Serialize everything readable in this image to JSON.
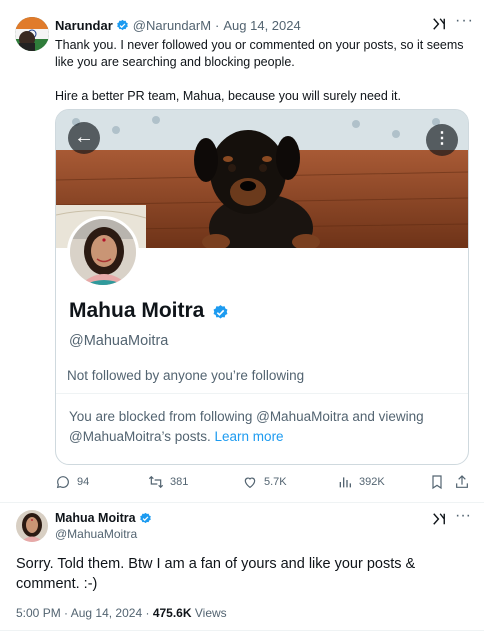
{
  "tweet1": {
    "author_name": "Narundar",
    "author_handle": "@NarundarM",
    "separator": "·",
    "date": "Aug 14, 2024",
    "text": "Thank you. I never followed you or commented on your posts, so it seems like you are searching and blocking people.\n\nHire a better PR team, Mahua, because you will surely need it.",
    "actions": {
      "replies": "94",
      "reposts": "381",
      "likes": "5.7K",
      "views": "392K"
    }
  },
  "card": {
    "profile_name": "Mahua Moitra",
    "profile_handle": "@MahuaMoitra",
    "followers_note": "Not followed by anyone you’re following",
    "blocked_text": "You are blocked from following @MahuaMoitra and viewing @MahuaMoitra’s posts.",
    "learn_more": "Learn more"
  },
  "tweet2": {
    "author_name": "Mahua Moitra",
    "author_handle": "@MahuaMoitra",
    "text": "Sorry. Told them. Btw I am a fan of yours and like your posts & comment. :-)",
    "time": "5:00 PM",
    "date": "Aug 14, 2024",
    "views_count": "475.6K",
    "views_label": "Views"
  },
  "icons": {
    "grok": "grok-icon",
    "more": "more-icon"
  },
  "colors": {
    "accent": "#1d9bf0",
    "muted": "#536471",
    "text": "#0f1419"
  }
}
